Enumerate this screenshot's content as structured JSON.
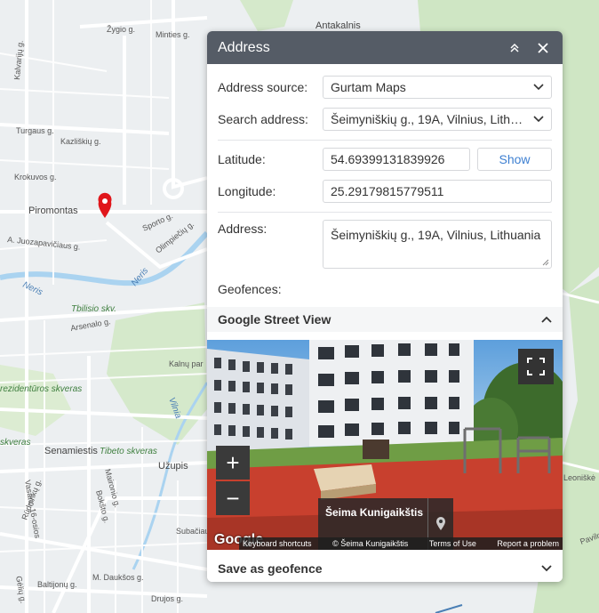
{
  "map": {
    "labels": {
      "antakalnis": "Antakalnis",
      "zygio": "Žygio g.",
      "mintes": "Minties g.",
      "kalvariju": "Kalvarijų g.",
      "turgaus": "Turgaus g.",
      "kazliskiu": "Kazliškių g.",
      "krokuvos": "Krokuvos g.",
      "piromontas": "Piromontas",
      "juozapaviciaus": "A. Juozapavičiaus g.",
      "sporto": "Sporto g.",
      "olimpieciu": "Olimpiečių g.",
      "neris1": "Neris",
      "neris2": "Neris",
      "tbilisio": "Tbilisio skv.",
      "arsenalo": "Arsenalo g.",
      "kalnu": "Kalnų par",
      "vilnia": "Vilnia",
      "rezidenturos": "rezidentūros skveras",
      "skveras": "skveras",
      "senamiestis": "Senamiestis",
      "tibeto": "Tibeto skveras",
      "uzupis": "Užupis",
      "vasario": "Vasario 16-osios",
      "maironio": "Maironio g.",
      "bokstu": "Bokšto g.",
      "subacius": "Subačiaus",
      "rudninku": "Rūdninkų g.",
      "geliju": "Gėlių g.",
      "dauksos": "M. Daukšos g.",
      "drujos": "Drujos g.",
      "baltijonu": "Baltijonų g.",
      "leoniskes": "Leoniškė",
      "pavilnio": "Pavilnio"
    }
  },
  "panel": {
    "title": "Address",
    "address_source_label": "Address source:",
    "address_source_value": "Gurtam Maps",
    "search_address_label": "Search address:",
    "search_address_value": "Šeimyniškių g., 19A, Vilnius, Lithuania",
    "latitude_label": "Latitude:",
    "latitude_value": "54.69399131839926",
    "show_label": "Show",
    "longitude_label": "Longitude:",
    "longitude_value": "25.29179815779511",
    "address_label": "Address:",
    "address_value": "Šeimyniškių g., 19A, Vilnius, Lithuania",
    "geofences_label": "Geofences:",
    "street_view_title": "Google Street View",
    "save_geofence_title": "Save as geofence"
  },
  "street_view": {
    "place_name": "Šeima Kunigaikštis",
    "google_logo": "Google",
    "keyboard_shortcuts": "Keyboard shortcuts",
    "copyright": "© Šeima Kunigaikštis",
    "terms": "Terms of Use",
    "report": "Report a problem",
    "zoom_in": "+",
    "zoom_out": "−"
  },
  "colors": {
    "header_bg": "#555c66",
    "link_blue": "#3d7fd1",
    "pin_red": "#e0161b",
    "river": "#aad3f0"
  }
}
